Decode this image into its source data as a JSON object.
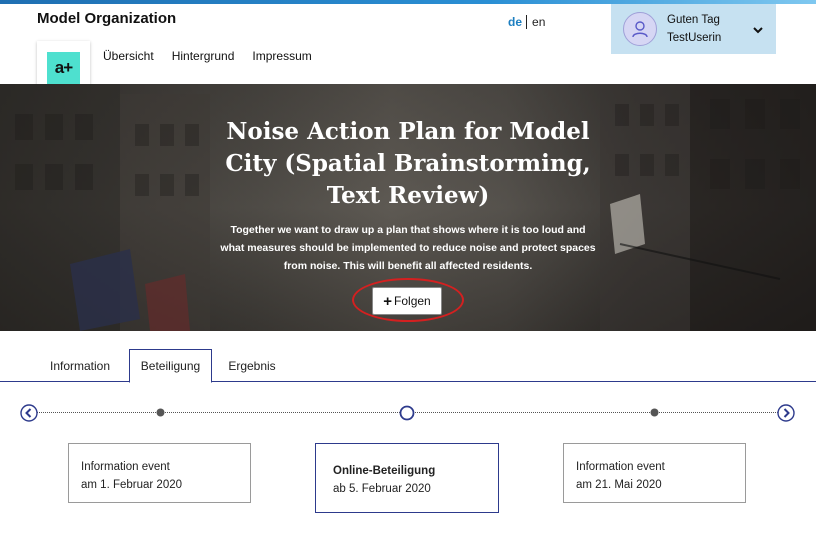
{
  "header": {
    "org_title": "Model Organization",
    "logo_text": "a+",
    "nav": [
      "Übersicht",
      "Hintergrund",
      "Impressum"
    ],
    "lang": {
      "de": "de",
      "en": "en",
      "active": "de"
    },
    "user": {
      "greeting": "Guten Tag",
      "name": "TestUserin"
    }
  },
  "hero": {
    "title": "Noise Action Plan for Model City (Spatial Brainstorming, Text Review)",
    "description": "Together we want to draw up a plan that shows where it is too loud and what measures should be implemented to reduce noise and protect spaces from noise. This will benefit all affected residents.",
    "follow_label": "Folgen"
  },
  "tabs": {
    "items": [
      "Information",
      "Beteiligung",
      "Ergebnis"
    ],
    "active": "Beteiligung"
  },
  "timeline": {
    "phases": [
      {
        "title": "Information event",
        "date": "am 1. Februar 2020",
        "active": false
      },
      {
        "title": "Online-Beteiligung",
        "date": "ab 5. Februar 2020",
        "active": true
      },
      {
        "title": "Information event",
        "date": "am 21. Mai 2020",
        "active": false
      }
    ]
  },
  "colors": {
    "accent": "#2d3a8c",
    "link_blue": "#1d7fc1",
    "user_box": "#c6e1f1",
    "logo": "#4ee0cf",
    "highlight_ring": "#d42020"
  },
  "icons": [
    "user-avatar-icon",
    "chevron-down-icon",
    "plus-icon",
    "chevron-left-circle-icon",
    "chevron-right-circle-icon"
  ]
}
